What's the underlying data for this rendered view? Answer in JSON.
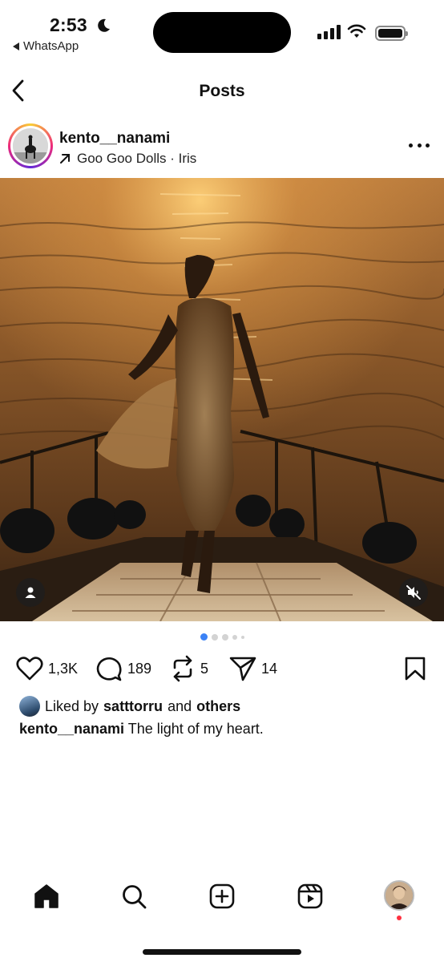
{
  "status_bar": {
    "time": "2:53",
    "back_app": "WhatsApp"
  },
  "nav": {
    "title": "Posts"
  },
  "post": {
    "username": "kento__nanami",
    "music": "Goo Goo Dolls · Iris",
    "likes": "1,3K",
    "comments": "189",
    "reposts": "5",
    "shares": "14",
    "liked_by": {
      "prefix": "Liked by",
      "user": "satttorru",
      "and": "and",
      "others": "others"
    },
    "caption": {
      "user": "kento__nanami",
      "text": "The light of my heart."
    },
    "carousel": {
      "current": 1,
      "total": 5
    }
  },
  "icons": {
    "status": [
      "moon-icon",
      "signal-icon",
      "wifi-icon",
      "battery-icon"
    ],
    "actions": [
      "heart-icon",
      "comment-icon",
      "repost-icon",
      "share-icon",
      "bookmark-icon"
    ],
    "tabbar": [
      "home-icon",
      "search-icon",
      "create-icon",
      "reels-icon",
      "profile-avatar"
    ]
  },
  "colors": {
    "active_dot": "#3b82f6",
    "notification": "#ff3040",
    "story_ring": [
      "#f9ce34",
      "#ee2a7b",
      "#6228d7"
    ]
  }
}
